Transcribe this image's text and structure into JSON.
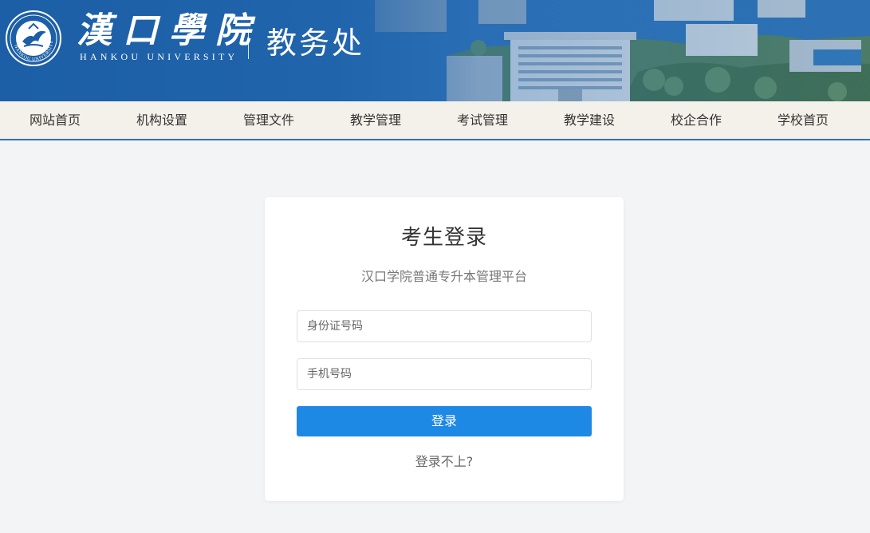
{
  "header": {
    "school_name_cn": "漢口學院",
    "school_name_en": "HANKOU UNIVERSITY",
    "seal_text": "HANKOU UNIVERSITY",
    "department": "教务处"
  },
  "nav": {
    "items": [
      {
        "label": "网站首页"
      },
      {
        "label": "机构设置"
      },
      {
        "label": "管理文件"
      },
      {
        "label": "教学管理"
      },
      {
        "label": "考试管理"
      },
      {
        "label": "教学建设"
      },
      {
        "label": "校企合作"
      },
      {
        "label": "学校首页"
      }
    ]
  },
  "login": {
    "title": "考生登录",
    "subtitle": "汉口学院普通专升本管理平台",
    "id_placeholder": "身份证号码",
    "phone_placeholder": "手机号码",
    "submit_label": "登录",
    "help_link": "登录不上?"
  },
  "colors": {
    "banner_blue": "#1b5ea6",
    "nav_bg": "#f4f1ea",
    "nav_border": "#2c73c4",
    "button_blue": "#1e88e5",
    "page_bg": "#f3f4f6"
  }
}
